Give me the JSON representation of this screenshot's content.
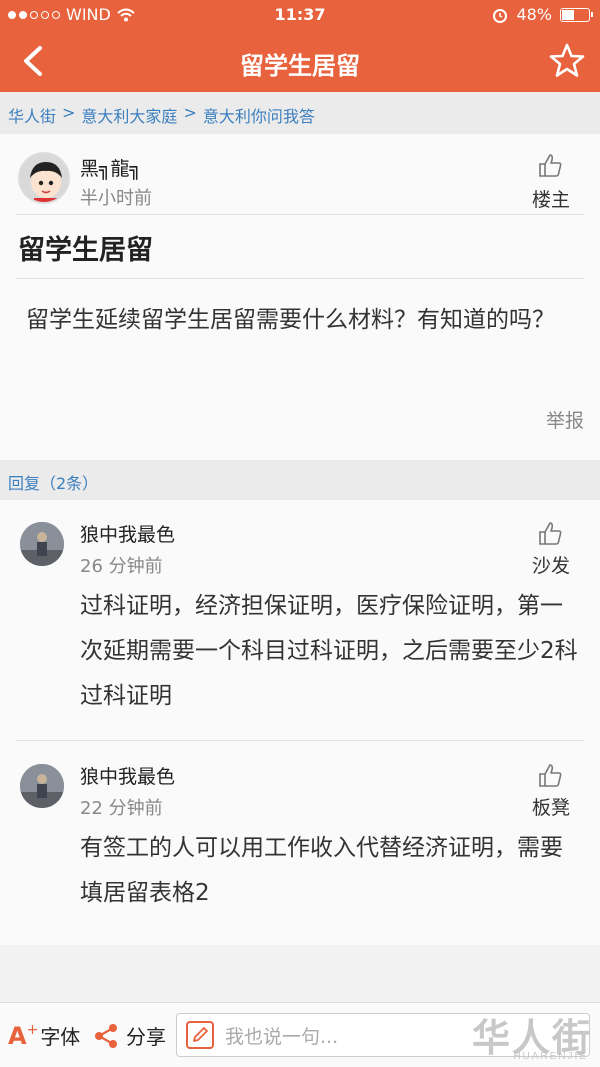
{
  "status_bar": {
    "carrier": "WIND",
    "signal_dots_filled": 2,
    "signal_dots_total": 5,
    "time": "11:37",
    "battery_percent": "48%",
    "battery_level": 0.48
  },
  "nav": {
    "title": "留学生居留"
  },
  "breadcrumb": {
    "items": [
      "华人街",
      "意大利大家庭",
      "意大利你问我答"
    ],
    "separator": ">"
  },
  "post": {
    "author": "黑╗龍╗",
    "time": "半小时前",
    "floor_label": "楼主",
    "title": "留学生居留",
    "body": "留学生延续留学生居留需要什么材料？有知道的吗？",
    "report_label": "举报"
  },
  "replies_header": "回复（2条）",
  "replies": [
    {
      "author": "狼中我最色",
      "time": "26 分钟前",
      "floor_label": "沙发",
      "text": "过科证明，经济担保证明，医疗保险证明，第一次延期需要一个科目过科证明，之后需要至少2科过科证明"
    },
    {
      "author": "狼中我最色",
      "time": "22 分钟前",
      "floor_label": "板凳",
      "text": "有签工的人可以用工作收入代替经济证明，需要填居留表格2"
    }
  ],
  "bottom_bar": {
    "font_letter": "A",
    "font_plus": "+",
    "font_label": "字体",
    "share_label": "分享",
    "comment_placeholder": "我也说一句...",
    "watermark": "华人街",
    "watermark_sub": "HUARENJIE"
  },
  "colors": {
    "brand": "#e8633d",
    "link": "#3c7fc0"
  }
}
